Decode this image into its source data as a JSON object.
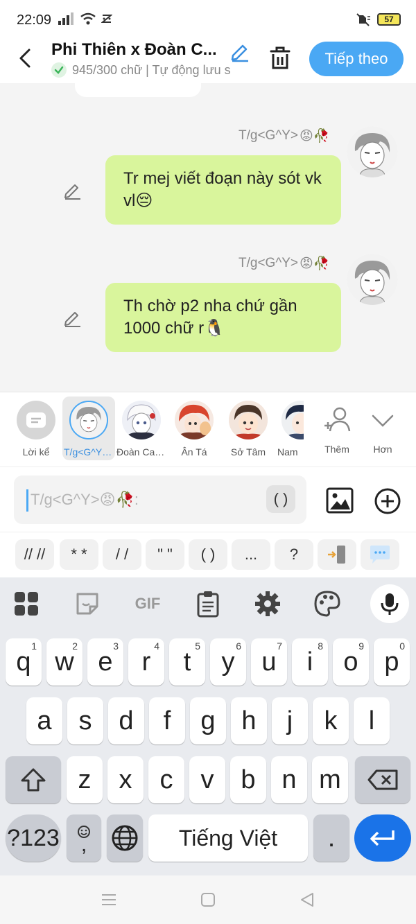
{
  "status_bar": {
    "time": "22:09",
    "battery": "57"
  },
  "header": {
    "title": "Phi Thiên x Đoàn C...",
    "subtitle": "945/300 chữ | Tự động lưu s",
    "next_button": "Tiếp theo"
  },
  "messages": [
    {
      "sender": "T/g<G^Y>",
      "text": "Tr mej viết đoạn này sót vk vl😔"
    },
    {
      "sender": "T/g<G^Y>",
      "text": "Th chờ p2 nha chứ gần 1000 chữ r🐧"
    }
  ],
  "sender_emoji": "😡🥀",
  "characters": [
    {
      "label": "Lời kể"
    },
    {
      "label": "T/g<G^Y>..."
    },
    {
      "label": "Đoàn Can..."
    },
    {
      "label": "Ân Tá"
    },
    {
      "label": "Sở Tâm"
    },
    {
      "label": "Nam"
    },
    {
      "label": "Thêm"
    },
    {
      "label": "Hơn"
    }
  ],
  "input": {
    "placeholder": "T/g<G^Y>😡🥀:",
    "paren_label": "( )"
  },
  "quick_format": [
    "// //",
    "* *",
    "/ /",
    "\" \"",
    "( )",
    "..."
  ],
  "quick_help": "?",
  "keyboard": {
    "row1": [
      {
        "k": "q",
        "n": "1"
      },
      {
        "k": "w",
        "n": "2"
      },
      {
        "k": "e",
        "n": "3"
      },
      {
        "k": "r",
        "n": "4"
      },
      {
        "k": "t",
        "n": "5"
      },
      {
        "k": "y",
        "n": "6"
      },
      {
        "k": "u",
        "n": "7"
      },
      {
        "k": "i",
        "n": "8"
      },
      {
        "k": "o",
        "n": "9"
      },
      {
        "k": "p",
        "n": "0"
      }
    ],
    "row2": [
      "a",
      "s",
      "d",
      "f",
      "g",
      "h",
      "j",
      "k",
      "l"
    ],
    "row3": [
      "z",
      "x",
      "c",
      "v",
      "b",
      "n",
      "m"
    ],
    "symbols_key": "?123",
    "emoji_comma_key": ",",
    "space_label": "Tiếng Việt",
    "period_key": ".",
    "gif_label": "GIF"
  },
  "colors": {
    "accent": "#4aa8f4",
    "bubble": "#d9f59c",
    "enter": "#1a73e8"
  }
}
